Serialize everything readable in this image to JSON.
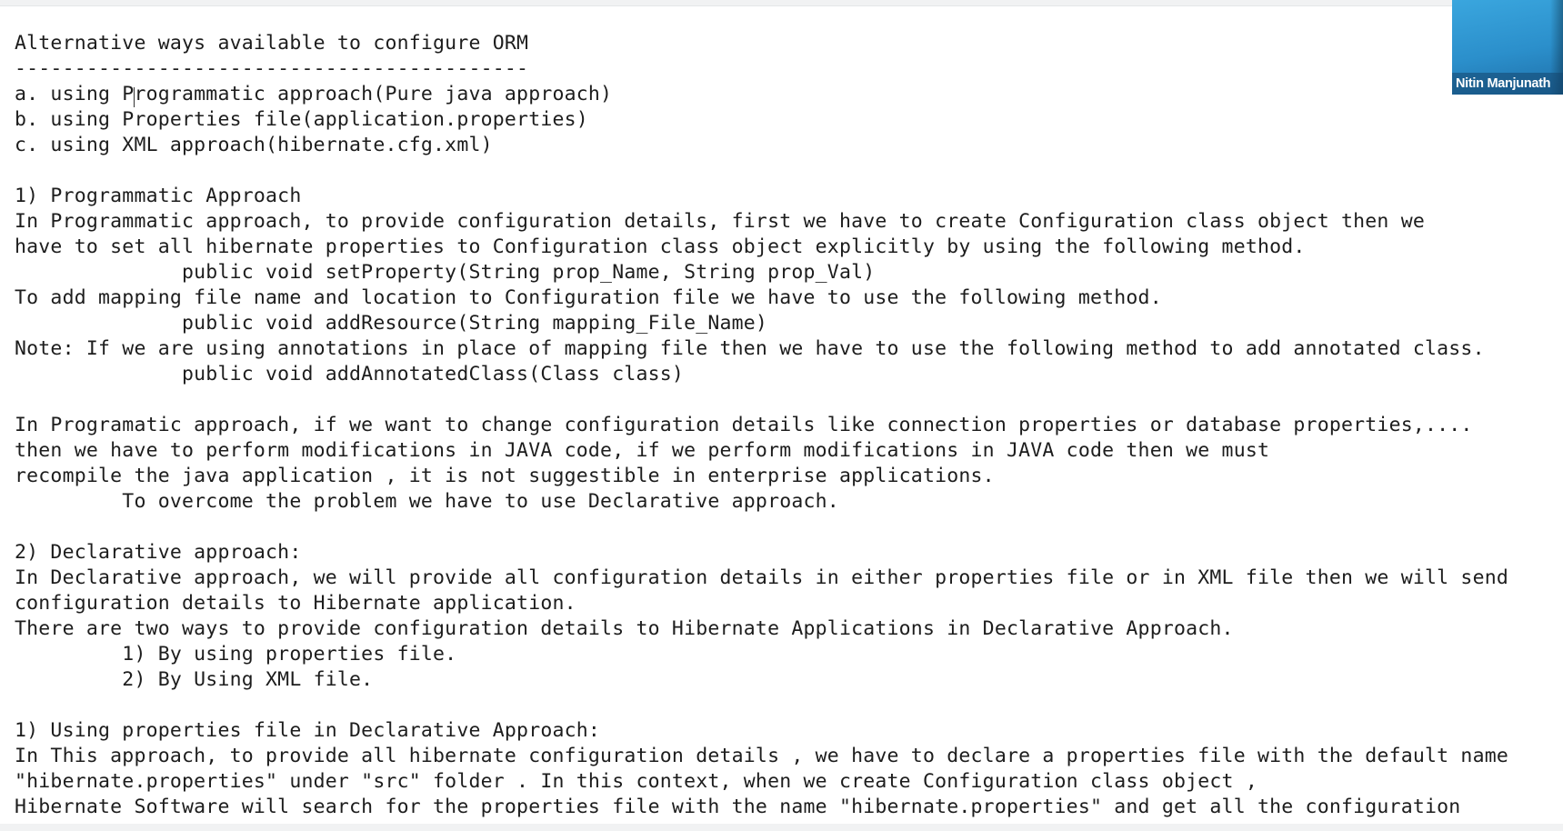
{
  "document": {
    "lines": [
      "Alternative ways available to configure ORM",
      "-------------------------------------------",
      "a. using Programmatic approach(Pure java approach)",
      "b. using Properties file(application.properties)",
      "c. using XML approach(hibernate.cfg.xml)",
      "",
      "1) Programmatic Approach",
      "In Programmatic approach, to provide configuration details, first we have to create Configuration class object then we",
      "have to set all hibernate properties to Configuration class object explicitly by using the following method.",
      "              public void setProperty(String prop_Name, String prop_Val)",
      "To add mapping file name and location to Configuration file we have to use the following method.",
      "              public void addResource(String mapping_File_Name)",
      "Note: If we are using annotations in place of mapping file then we have to use the following method to add annotated class.",
      "              public void addAnnotatedClass(Class class)",
      "",
      "In Programatic approach, if we want to change configuration details like connection properties or database properties,....",
      "then we have to perform modifications in JAVA code, if we perform modifications in JAVA code then we must",
      "recompile the java application , it is not suggestible in enterprise applications.",
      "         To overcome the problem we have to use Declarative approach.",
      "",
      "2) Declarative approach:",
      "In Declarative approach, we will provide all configuration details in either properties file or in XML file then we will send",
      "configuration details to Hibernate application.",
      "There are two ways to provide configuration details to Hibernate Applications in Declarative Approach.",
      "         1) By using properties file.",
      "         2) By Using XML file.",
      "",
      "1) Using properties file in Declarative Approach:",
      "In This approach, to provide all hibernate configuration details , we have to declare a properties file with the default name",
      "\"hibernate.properties\" under \"src\" folder . In this context, when we create Configuration class object ,",
      "Hibernate Software will search for the properties file with the name \"hibernate.properties\" and get all the configuration"
    ]
  },
  "video_tile": {
    "participant_name": "Nitin Manjunath"
  },
  "colors": {
    "text": "#1d1d1d",
    "background": "#ffffff",
    "video_tile": "#2b8fcb"
  }
}
